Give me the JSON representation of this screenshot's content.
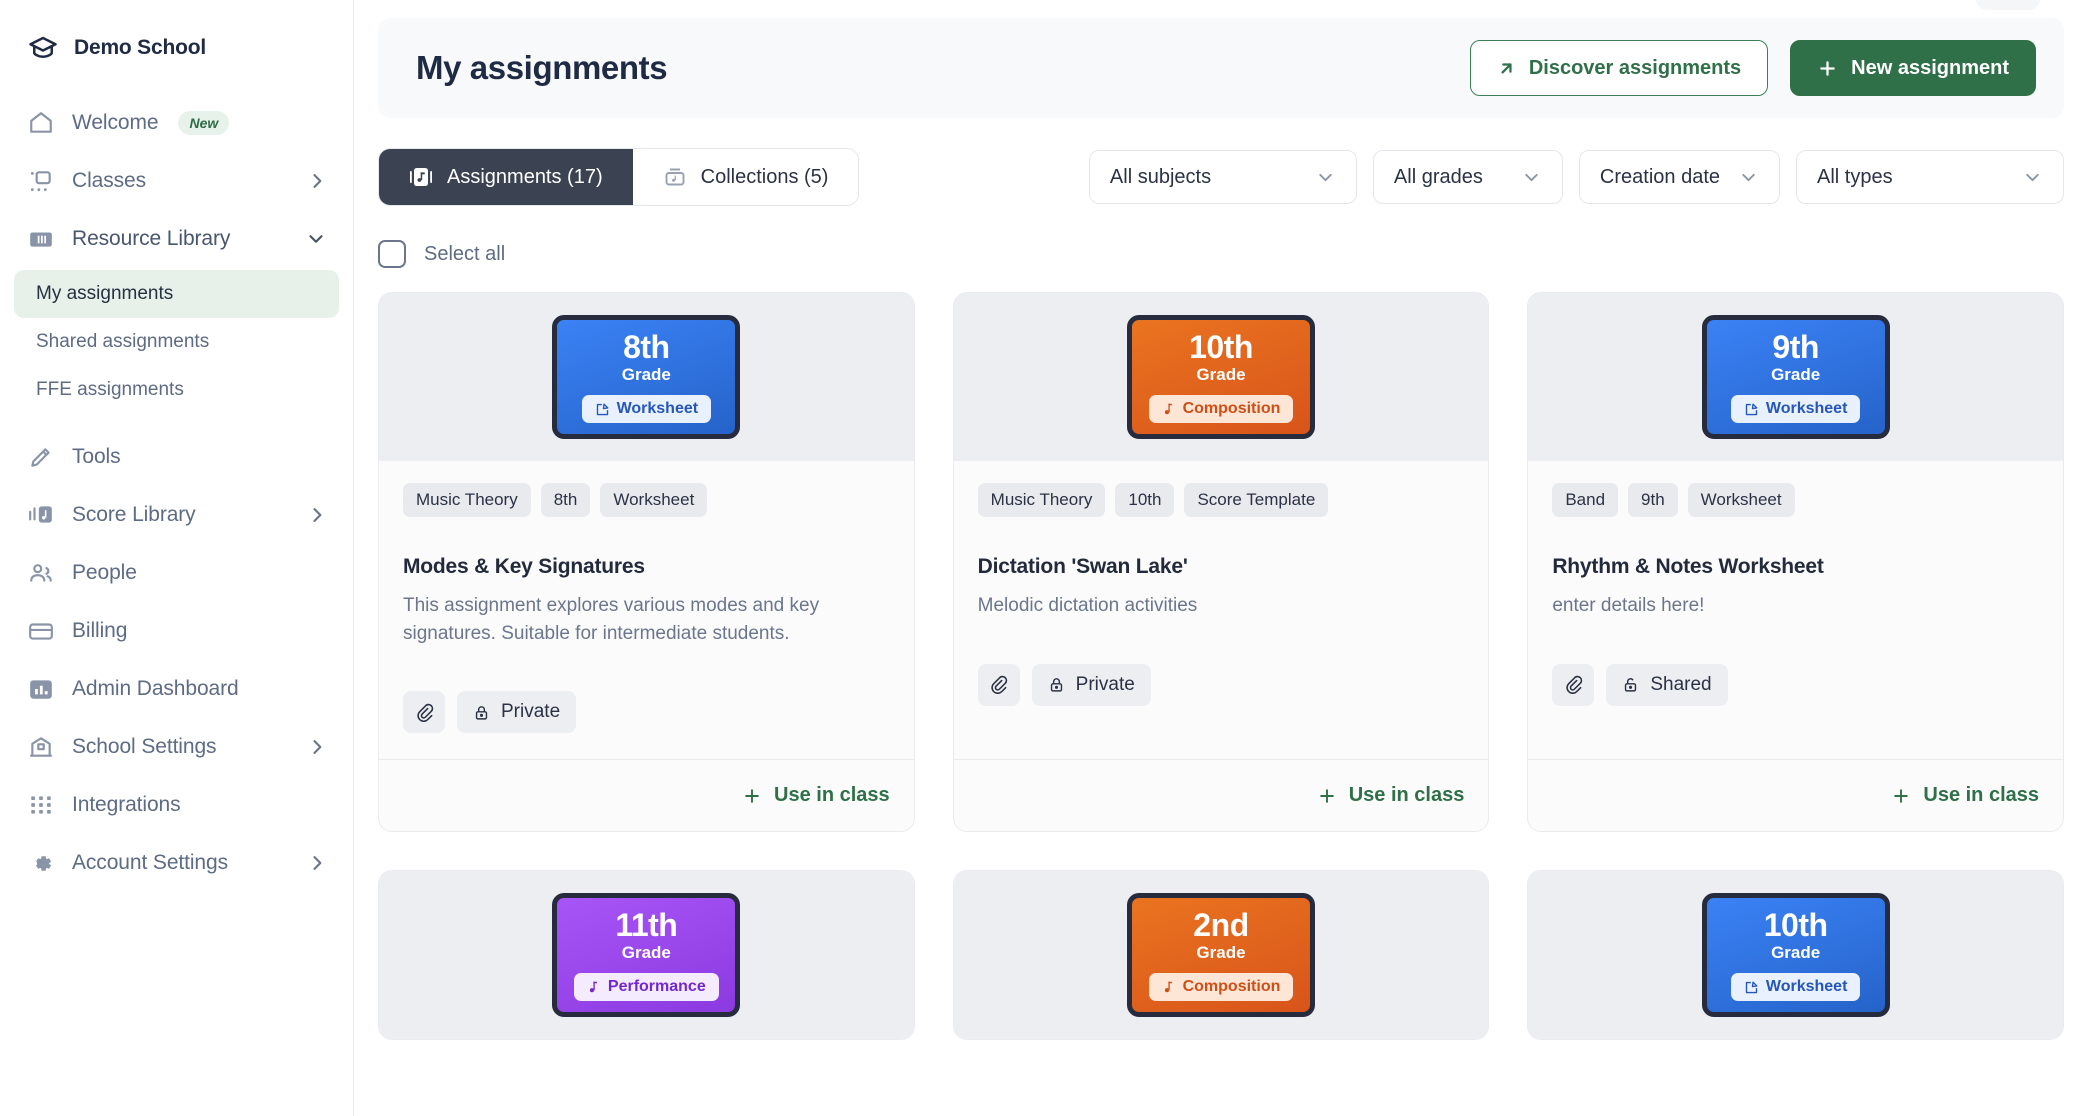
{
  "sidebar": {
    "brand": {
      "name": "Demo School",
      "icon": "graduation-cap-icon"
    },
    "items": [
      {
        "label": "Welcome",
        "icon": "home-icon",
        "badge": "New",
        "chevron": ""
      },
      {
        "label": "Classes",
        "icon": "classes-icon",
        "badge": "",
        "chevron": "chevron-right-icon"
      },
      {
        "label": "Resource Library",
        "icon": "library-icon",
        "badge": "",
        "chevron": "chevron-down-icon"
      }
    ],
    "sub_items": [
      {
        "label": "My assignments",
        "active": true
      },
      {
        "label": "Shared assignments",
        "active": false
      },
      {
        "label": "FFE assignments",
        "active": false
      }
    ],
    "items_lower": [
      {
        "label": "Tools",
        "icon": "pen-tool-icon",
        "chevron": ""
      },
      {
        "label": "Score Library",
        "icon": "score-icon",
        "chevron": "chevron-right-icon"
      },
      {
        "label": "People",
        "icon": "people-icon",
        "chevron": ""
      },
      {
        "label": "Billing",
        "icon": "card-icon",
        "chevron": ""
      },
      {
        "label": "Admin Dashboard",
        "icon": "bar-chart-icon",
        "chevron": ""
      },
      {
        "label": "School Settings",
        "icon": "school-icon",
        "chevron": "chevron-right-icon"
      },
      {
        "label": "Integrations",
        "icon": "grid-dots-icon",
        "chevron": ""
      },
      {
        "label": "Account Settings",
        "icon": "gear-icon",
        "chevron": "chevron-right-icon"
      }
    ]
  },
  "header": {
    "title": "My assignments",
    "discover_label": "Discover assignments",
    "discover_icon": "arrow-up-right-icon",
    "new_label": "New assignment",
    "new_icon": "plus-icon"
  },
  "toolbar": {
    "tabs": [
      {
        "label": "Assignments (17)",
        "icon": "assignment-icon",
        "active": true
      },
      {
        "label": "Collections (5)",
        "icon": "collection-icon",
        "active": false
      }
    ],
    "filters": [
      {
        "label": "All subjects",
        "icon": "chevron-down-icon"
      },
      {
        "label": "All grades",
        "icon": "chevron-down-icon"
      },
      {
        "label": "Creation date",
        "icon": "chevron-down-icon"
      },
      {
        "label": "All types",
        "icon": "chevron-down-icon"
      }
    ],
    "select_all_label": "Select all",
    "select_all_checked": false
  },
  "colors": {
    "accent_green": "#2f7048",
    "tab_active_bg": "#3b4252",
    "tile_blue": "#2f72e0",
    "tile_orange": "#e0621d",
    "tile_purple": "#9046e8",
    "badge_new_bg": "#e6f2ea",
    "badge_new_text": "#2f6b46"
  },
  "cards": [
    {
      "tile": {
        "grade": "8th",
        "grade_sub": "Grade",
        "chip": "Worksheet",
        "chip_icon": "worksheet-icon",
        "color": "blue"
      },
      "tags": [
        "Music Theory",
        "8th",
        "Worksheet"
      ],
      "title": "Modes & Key Signatures",
      "description": "This assignment explores various modes and key signatures. Suitable for intermediate students.",
      "attachment_icon": "paperclip-icon",
      "visibility": "Private",
      "visibility_icon": "lock-closed-icon",
      "action_label": "Use in class",
      "action_icon": "plus-icon"
    },
    {
      "tile": {
        "grade": "10th",
        "grade_sub": "Grade",
        "chip": "Composition",
        "chip_icon": "music-note-icon",
        "color": "orange"
      },
      "tags": [
        "Music Theory",
        "10th",
        "Score Template"
      ],
      "title": "Dictation 'Swan Lake'",
      "description": "Melodic dictation activities",
      "attachment_icon": "paperclip-icon",
      "visibility": "Private",
      "visibility_icon": "lock-closed-icon",
      "action_label": "Use in class",
      "action_icon": "plus-icon"
    },
    {
      "tile": {
        "grade": "9th",
        "grade_sub": "Grade",
        "chip": "Worksheet",
        "chip_icon": "worksheet-icon",
        "color": "blue"
      },
      "tags": [
        "Band",
        "9th",
        "Worksheet"
      ],
      "title": "Rhythm & Notes Worksheet",
      "description": "enter details here!",
      "attachment_icon": "paperclip-icon",
      "visibility": "Shared",
      "visibility_icon": "lock-open-icon",
      "action_label": "Use in class",
      "action_icon": "plus-icon"
    }
  ],
  "cards_row2": [
    {
      "tile": {
        "grade": "11th",
        "grade_sub": "Grade",
        "chip": "Performance",
        "chip_icon": "music-note-icon",
        "color": "purple"
      }
    },
    {
      "tile": {
        "grade": "2nd",
        "grade_sub": "Grade",
        "chip": "Composition",
        "chip_icon": "music-note-icon",
        "color": "orange"
      }
    },
    {
      "tile": {
        "grade": "10th",
        "grade_sub": "Grade",
        "chip": "Worksheet",
        "chip_icon": "worksheet-icon",
        "color": "blue"
      }
    }
  ]
}
